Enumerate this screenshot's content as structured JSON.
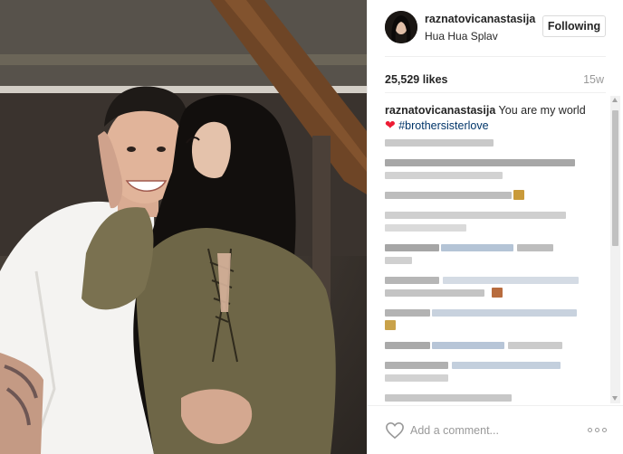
{
  "post": {
    "username": "raznatovicanastasija",
    "location": "Hua Hua Splav",
    "follow_label": "Following",
    "likes": "25,529 likes",
    "age": "15w"
  },
  "caption": {
    "username": "raznatovicanastasija",
    "text": "You are my world",
    "heart": "❤",
    "hashtag": "#brothersisterlove"
  },
  "comments": {
    "obscured": true
  },
  "footer": {
    "comment_placeholder": "Add a comment..."
  },
  "colors": {
    "heart": "#ed1c34",
    "hashtag": "#003569",
    "muted": "#999999",
    "border": "#efefef"
  },
  "icons": {
    "like": "heart-outline-icon",
    "more": "more-options-icon"
  }
}
